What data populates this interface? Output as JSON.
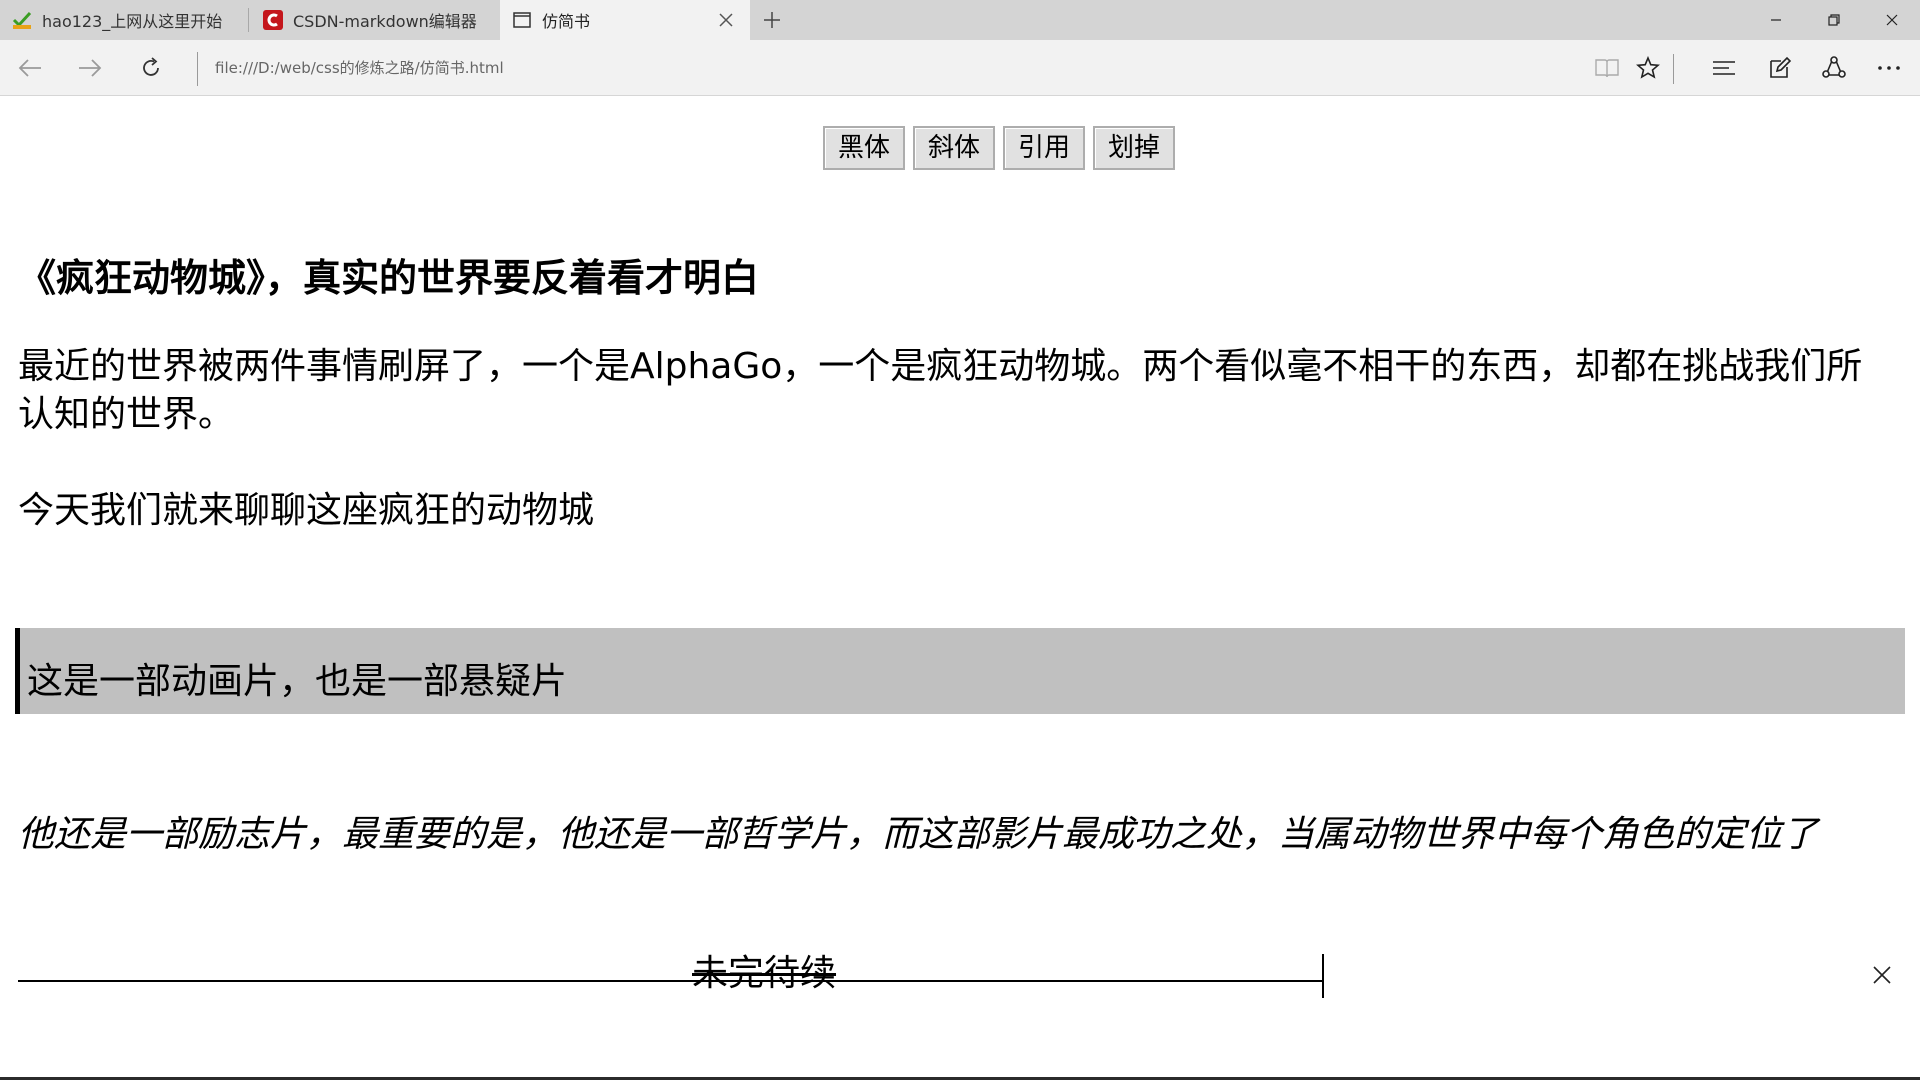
{
  "tabs": [
    {
      "label": "hao123_上网从这里开始",
      "icon": "hao123-favicon",
      "active": false
    },
    {
      "label": "CSDN-markdown编辑器",
      "icon": "csdn-favicon",
      "active": false
    },
    {
      "label": "仿简书",
      "icon": "page-icon",
      "active": true
    }
  ],
  "address": {
    "url": "file:///D:/web/css的修炼之路/仿简书.html"
  },
  "toolbar": {
    "bold_label": "黑体",
    "italic_label": "斜体",
    "quote_label": "引用",
    "strike_label": "划掉"
  },
  "article": {
    "title": "《疯狂动物城》，真实的世界要反着看才明白",
    "paragraph1": "最近的世界被两件事情刷屏了，一个是AlphaGo，一个是疯狂动物城。两个看似毫不相干的东西，却都在挑战我们所认知的世界。",
    "paragraph2": "今天我们就来聊聊这座疯狂的动物城",
    "quote": "这是一部动画片，也是一部悬疑片",
    "italic_paragraph": "他还是一部励志片，最重要的是，他还是一部哲学片，而这部影片最成功之处，当属动物世界中每个角色的定位了",
    "strike_text": "未完待续"
  },
  "colors": {
    "tabbar_bg": "#d4d4d4",
    "active_tab_bg": "#f2f2f2",
    "quote_bg": "#c0c0c0",
    "csdn_red": "#c4161c",
    "hao123_green": "#3a9d23"
  }
}
